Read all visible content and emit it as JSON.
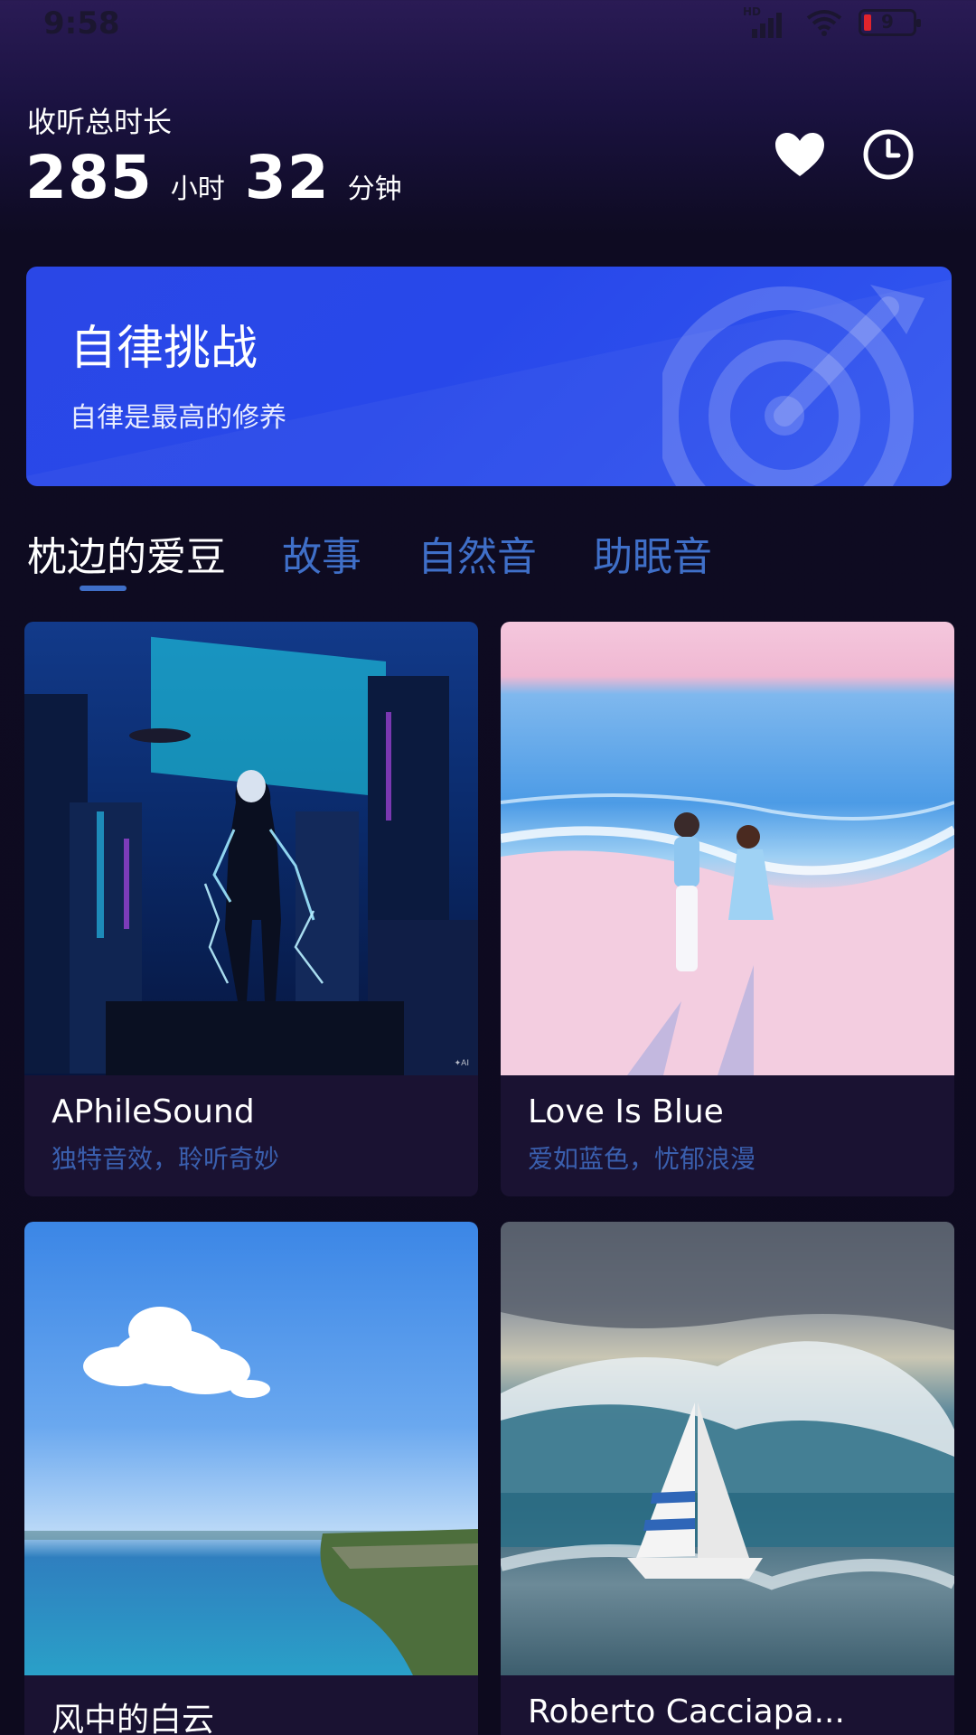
{
  "status_bar": {
    "time": "9:58",
    "network_type": "HD",
    "battery_level": "9"
  },
  "header": {
    "listen_label": "收听总时长",
    "hours": "285",
    "hours_unit": "小时",
    "minutes": "32",
    "minutes_unit": "分钟",
    "icons": [
      "heart-icon",
      "clock-icon"
    ]
  },
  "banner": {
    "title": "自律挑战",
    "subtitle": "自律是最高的修养",
    "icon": "target-icon"
  },
  "tabs": [
    {
      "label": "枕边的爱豆",
      "active": true
    },
    {
      "label": "故事",
      "active": false
    },
    {
      "label": "自然音",
      "active": false
    },
    {
      "label": "助眠音",
      "active": false
    }
  ],
  "cards": [
    {
      "title": "APhileSound",
      "subtitle": "独特音效，聆听奇妙"
    },
    {
      "title": "Love Is Blue",
      "subtitle": "爱如蓝色，忧郁浪漫"
    },
    {
      "title": "风中的白云",
      "subtitle": ""
    },
    {
      "title": "Roberto Cacciapa...",
      "subtitle": ""
    }
  ],
  "colors": {
    "accent": "#3f6fc8",
    "banner": "#2a47e6",
    "background": "#0d0a1e",
    "card": "#1a1232"
  }
}
